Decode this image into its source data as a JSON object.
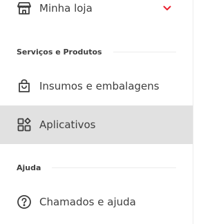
{
  "store": {
    "label": "Minha loja",
    "icon": "store-icon",
    "chevron_icon": "chevron-down-icon",
    "accent_color": "#ea1d2c"
  },
  "sections": [
    {
      "title": "Serviços e Produtos",
      "items": [
        {
          "label": "Insumos e embalagens",
          "icon": "shopping-bag-icon"
        },
        {
          "label": "Aplicativos",
          "icon": "apps-grid-icon",
          "active": true
        }
      ]
    },
    {
      "title": "Ajuda",
      "items": [
        {
          "label": "Chamados e ajuda",
          "icon": "help-circle-icon"
        }
      ]
    }
  ]
}
